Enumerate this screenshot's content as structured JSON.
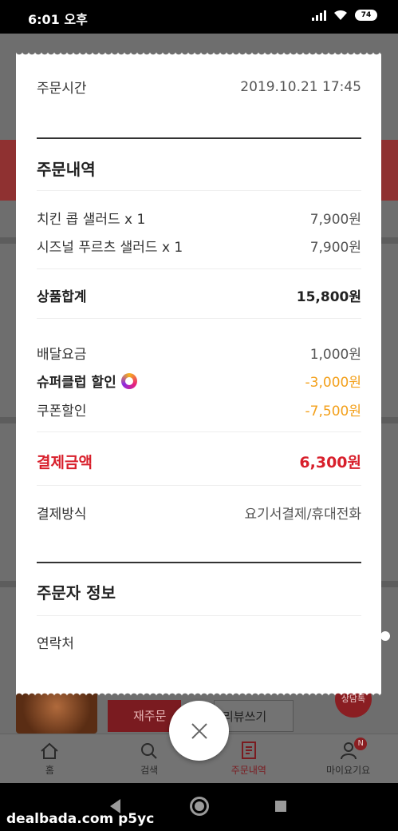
{
  "status_bar": {
    "time": "6:01 오후",
    "battery": "74"
  },
  "background": {
    "reorder_label": "재주문",
    "review_label": "리뷰쓰기",
    "chat_label": "상담톡",
    "nav": [
      {
        "label": "홈",
        "icon": "home-icon"
      },
      {
        "label": "검색",
        "icon": "search-icon"
      },
      {
        "label": "주문내역",
        "icon": "order-list-icon",
        "active": true
      },
      {
        "label": "마이요기요",
        "icon": "person-icon",
        "badge": "N"
      }
    ]
  },
  "receipt": {
    "order_time_label": "주문시간",
    "order_time_value": "2019.10.21 17:45",
    "order_details_title": "주문내역",
    "items": [
      {
        "name": "치킨 콥 샐러드 x 1",
        "price": "7,900원"
      },
      {
        "name": "시즈널 푸르츠 샐러드 x 1",
        "price": "7,900원"
      }
    ],
    "subtotal_label": "상품합계",
    "subtotal_value": "15,800원",
    "delivery_fee_label": "배달요금",
    "delivery_fee_value": "1,000원",
    "superclub_label": "슈퍼클럽 할인",
    "superclub_value": "-3,000원",
    "coupon_label": "쿠폰할인",
    "coupon_value": "-7,500원",
    "total_label": "결제금액",
    "total_value": "6,300원",
    "payment_method_label": "결제방식",
    "payment_method_value": "요기서결제/휴대전화",
    "orderer_title": "주문자 정보",
    "contact_label": "연락처"
  },
  "watermark": "dealbada.com  p5yc",
  "colors": {
    "accent_red": "#d81f2b",
    "discount_orange": "#f3a01b"
  }
}
